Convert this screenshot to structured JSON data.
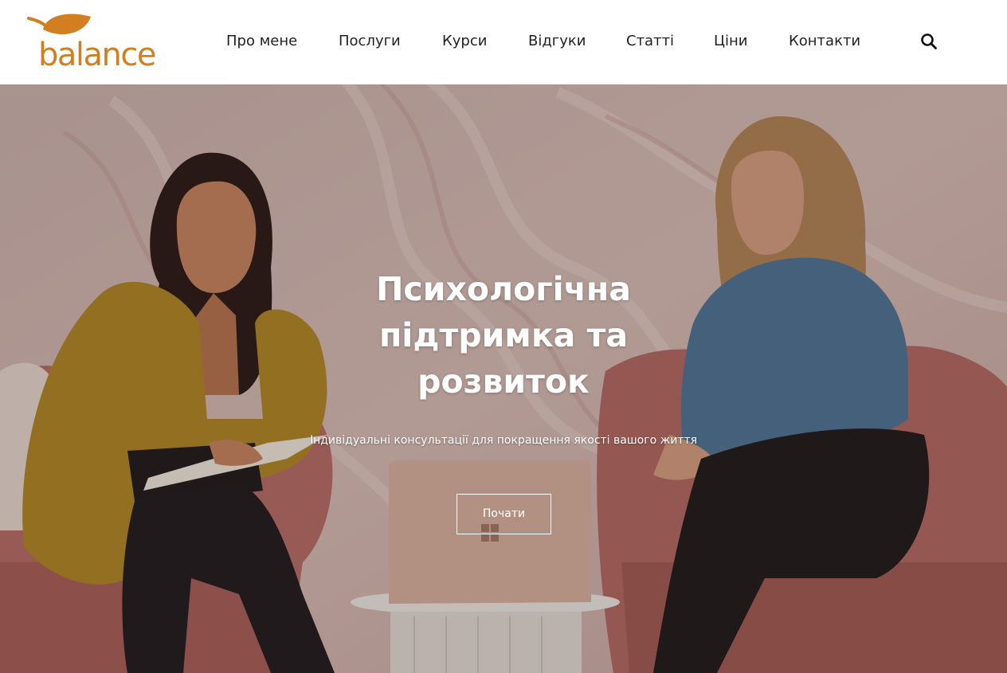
{
  "brand": {
    "name": "balance",
    "color": "#d27f22",
    "icon": "leaf-icon"
  },
  "nav": {
    "items": [
      {
        "label": "Про мене"
      },
      {
        "label": "Послуги"
      },
      {
        "label": "Курси"
      },
      {
        "label": "Відгуки"
      },
      {
        "label": "Статті"
      },
      {
        "label": "Ціни"
      },
      {
        "label": "Контакти"
      }
    ],
    "search_icon": "search-icon"
  },
  "hero": {
    "title": "Психологічна підтримка та розвиток",
    "subtitle": "Індивідуальні консультації для покращення якості вашого життя",
    "button_label": "Почати",
    "background": "photo-two-women-talking"
  }
}
